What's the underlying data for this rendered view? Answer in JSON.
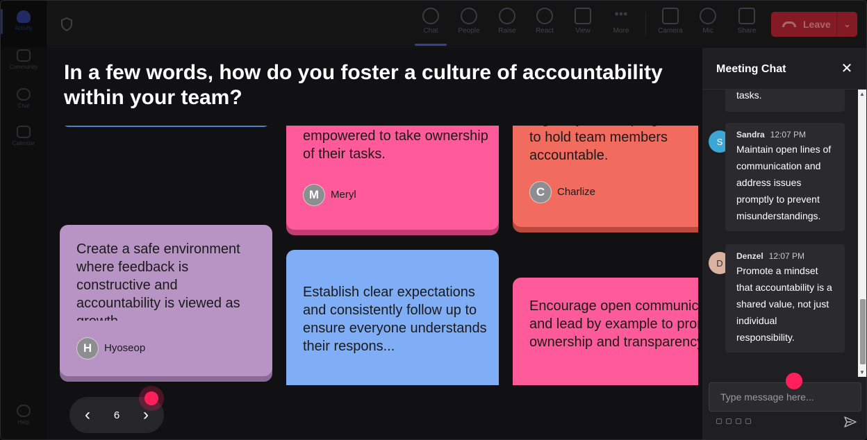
{
  "rail": {
    "items": [
      {
        "label": "Activity"
      },
      {
        "label": "Community"
      },
      {
        "label": "Chat"
      },
      {
        "label": "Calendar"
      }
    ],
    "help": "Help"
  },
  "toolbar": {
    "chat": "Chat",
    "people": "People",
    "raise": "Raise",
    "react": "React",
    "view": "View",
    "more": "More",
    "camera": "Camera",
    "mic": "Mic",
    "share": "Share",
    "leave": "Leave"
  },
  "question": "In a few words, how do you foster a culture of accountability within your team?",
  "notes": [
    {
      "text": "empowered to take ownership of their tasks.",
      "author": "Meryl",
      "initial": "M",
      "color": "#ff5a9a"
    },
    {
      "text": "regularly review progress to hold team members accountable.",
      "author": "Charlize",
      "initial": "C",
      "color": "#f26b5f"
    },
    {
      "text": "Create a safe environment where feedback is constructive and accountability is viewed as growth",
      "author": "Hyoseop",
      "initial": "H",
      "color": "#b794c4"
    },
    {
      "text": "Establish clear expectations and consistently follow up to ensure everyone understands their respons...",
      "author": "",
      "initial": "",
      "color": "#7faef7"
    },
    {
      "text": "Encourage open communication and lead by example to promote ownership and transparency",
      "author": "",
      "initial": "",
      "color": "#ff5a9a"
    }
  ],
  "pager": {
    "page": "6"
  },
  "chat": {
    "title": "Meeting Chat",
    "partial": "tasks.",
    "messages": [
      {
        "name": "Sandra",
        "time": "12:07 PM",
        "initial": "S",
        "text": "Maintain open lines of communication and address issues promptly to prevent misunderstandings."
      },
      {
        "name": "Denzel",
        "time": "12:07 PM",
        "initial": "D",
        "text": "Promote a mindset that accountability is a shared value, not just individual responsibility."
      }
    ],
    "placeholder": "Type message here..."
  }
}
